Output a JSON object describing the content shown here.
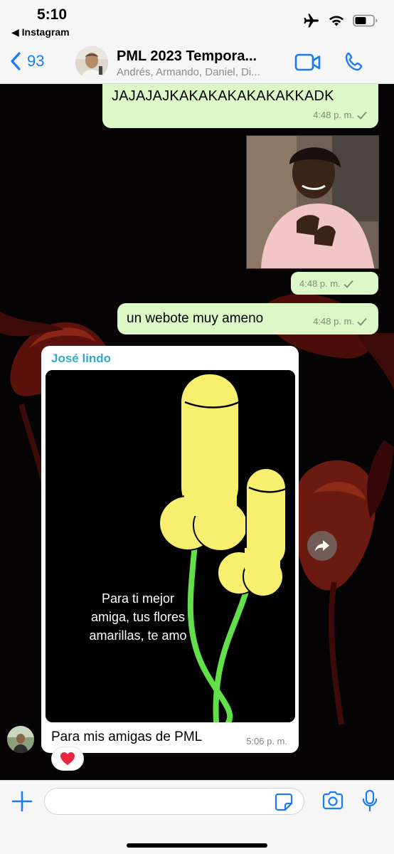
{
  "status_bar": {
    "time": "5:10",
    "back_app": "◀ Instagram"
  },
  "header": {
    "back_count": "93",
    "title": "PML 2023 Tempora...",
    "members": "Andrés, Armando, Daniel, Di..."
  },
  "messages": [
    {
      "direction": "outgoing",
      "text": "JAJAJAJKAKAKAKAKAKAKKADK",
      "time": "4:48 p. m.",
      "status": "sent"
    },
    {
      "direction": "outgoing",
      "type": "image",
      "time": "4:48 p. m.",
      "status": "sent"
    },
    {
      "direction": "outgoing",
      "text": "un webote muy ameno",
      "time": "4:48 p. m.",
      "status": "sent"
    },
    {
      "direction": "incoming",
      "sender": "José lindo",
      "type": "image",
      "image_caption": "Para ti mejor amiga, tus flores amarillas, te amo",
      "image_caption_lines": [
        "Para ti mejor",
        "amiga, tus flores",
        "amarillas, te amo"
      ],
      "text": "Para mis amigas de PML",
      "time": "5:06 p. m.",
      "reaction": "❤️"
    }
  ],
  "input": {
    "placeholder": ""
  },
  "colors": {
    "accent": "#1a7cf5",
    "outgoing_bubble": "#dcf8c6",
    "incoming_bubble": "#ffffff",
    "sender_name": "#35aac8",
    "flower_yellow": "#f7ef6e",
    "stem_green": "#62e04a"
  }
}
